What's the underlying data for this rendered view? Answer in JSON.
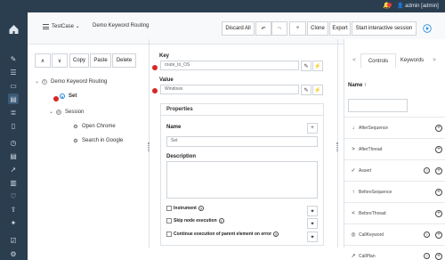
{
  "topbar": {
    "user": "admin [admin]"
  },
  "header": {
    "case_type": "TestCase ⌄",
    "name": "Demo Keyword Routing",
    "discard_all": "Discard All",
    "clone": "Clone",
    "export": "Export",
    "start_session": "Start interactive session"
  },
  "tree_toolbar": {
    "copy": "Copy",
    "paste": "Paste",
    "delete": "Delete",
    "up": "∧",
    "down": "∨"
  },
  "tree": {
    "root": "Demo Keyword Routing",
    "set": "Set",
    "session": "Session",
    "open_chrome": "Open Chrome",
    "search_google": "Search in Google"
  },
  "props": {
    "key_label": "Key",
    "key_value": "route_to_OS",
    "value_label": "Value",
    "value_value": "Windows",
    "properties_title": "Properties",
    "name_label": "Name",
    "name_value": "Set",
    "description_label": "Description",
    "instrument": "Instrument",
    "skip": "Skip node execution",
    "continue": "Continue execution of parent element on error"
  },
  "right": {
    "tab_controls": "Controls",
    "tab_keywords": "Keywords",
    "sort_label": "Name ↑",
    "items": [
      {
        "name": "AfterSequence",
        "icon": "↓"
      },
      {
        "name": "AfterThread",
        "icon": ">"
      },
      {
        "name": "Assert",
        "icon": "✓"
      },
      {
        "name": "BeforeSequence",
        "icon": "↑"
      },
      {
        "name": "BeforeThread",
        "icon": "<"
      },
      {
        "name": "CallKeyword",
        "icon": "◎"
      },
      {
        "name": "CallPlan",
        "icon": "↗"
      }
    ]
  }
}
